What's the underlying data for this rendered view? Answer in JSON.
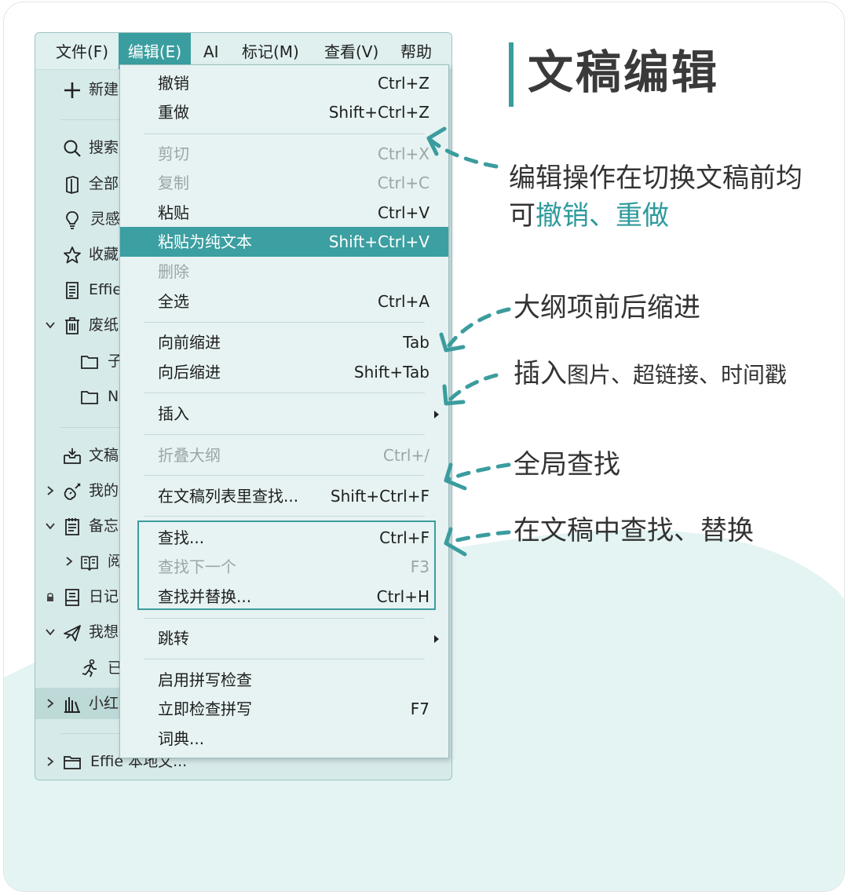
{
  "title": "文稿编辑",
  "menubar": {
    "items": [
      "文件(F)",
      "编辑(E)",
      "AI",
      "标记(M)",
      "查看(V)",
      "帮助(H)"
    ],
    "active_index": 1
  },
  "sidebar": {
    "new_label": "新建",
    "items": [
      {
        "label": "搜索",
        "icon": "search-icon"
      },
      {
        "label": "全部",
        "icon": "book-icon"
      },
      {
        "label": "灵感",
        "icon": "lightbulb-icon"
      },
      {
        "label": "收藏",
        "icon": "star-icon"
      },
      {
        "label": "Effie",
        "icon": "document-icon"
      },
      {
        "label": "废纸",
        "icon": "trash-icon"
      },
      {
        "label": "子",
        "icon": "folder-icon"
      },
      {
        "label": "N",
        "icon": "folder-icon"
      },
      {
        "label": "文稿",
        "icon": "inbox-icon"
      },
      {
        "label": "我的",
        "icon": "guitar-icon"
      },
      {
        "label": "备忘",
        "icon": "notepad-icon"
      },
      {
        "label": "阅",
        "icon": "open-book-icon"
      },
      {
        "label": "日记",
        "icon": "journal-icon"
      },
      {
        "label": "我想",
        "icon": "airplane-icon"
      },
      {
        "label": "已",
        "icon": "runner-icon"
      },
      {
        "label": "小红",
        "icon": "library-icon"
      }
    ],
    "bottom_label": "Effie 本地文..."
  },
  "menu": {
    "undo": {
      "label": "撤销",
      "shortcut": "Ctrl+Z"
    },
    "redo": {
      "label": "重做",
      "shortcut": "Shift+Ctrl+Z"
    },
    "cut": {
      "label": "剪切",
      "shortcut": "Ctrl+X"
    },
    "copy": {
      "label": "复制",
      "shortcut": "Ctrl+C"
    },
    "paste": {
      "label": "粘贴",
      "shortcut": "Ctrl+V"
    },
    "paste_plain": {
      "label": "粘贴为纯文本",
      "shortcut": "Shift+Ctrl+V"
    },
    "delete": {
      "label": "删除"
    },
    "select_all": {
      "label": "全选",
      "shortcut": "Ctrl+A"
    },
    "indent": {
      "label": "向前缩进",
      "shortcut": "Tab"
    },
    "outdent": {
      "label": "向后缩进",
      "shortcut": "Shift+Tab"
    },
    "insert": {
      "label": "插入"
    },
    "fold": {
      "label": "折叠大纲",
      "shortcut": "Ctrl+/"
    },
    "find_in_list": {
      "label": "在文稿列表里查找...",
      "shortcut": "Shift+Ctrl+F"
    },
    "find": {
      "label": "查找...",
      "shortcut": "Ctrl+F"
    },
    "find_next": {
      "label": "查找下一个",
      "shortcut": "F3"
    },
    "replace": {
      "label": "查找并替换...",
      "shortcut": "Ctrl+H"
    },
    "jump": {
      "label": "跳转"
    },
    "spell_enable": {
      "label": "启用拼写检查"
    },
    "spell_check": {
      "label": "立即检查拼写",
      "shortcut": "F7"
    },
    "dictionary": {
      "label": "词典..."
    }
  },
  "notes": {
    "undo_line1": "编辑操作在切换文稿前均",
    "undo_line2_prefix": "可",
    "undo_hl1": "撤销",
    "undo_sep": "、",
    "undo_hl2": "重做",
    "indent": "大纲项前后缩进",
    "insert_bold": "插入",
    "insert_rest": "图片、超链接、时间戳",
    "global_find": "全局查找",
    "doc_find": "在文稿中查找、替换"
  },
  "colors": {
    "accent": "#3b9c9e",
    "highlight": "#3c9fa1",
    "window_bg": "#d7eaea"
  }
}
